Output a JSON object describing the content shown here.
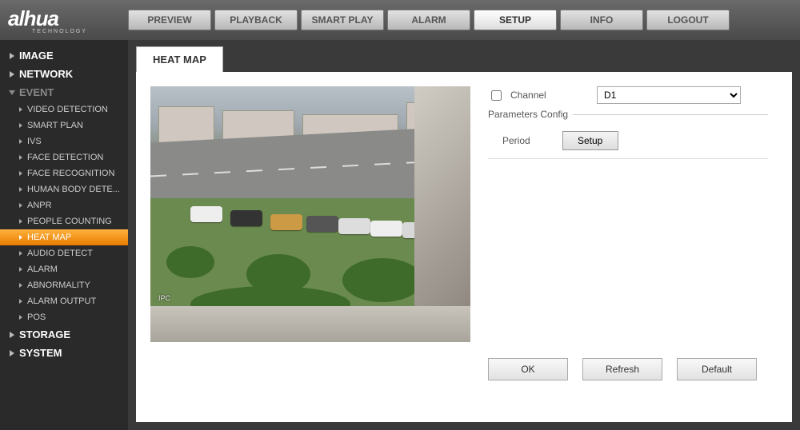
{
  "brand": {
    "name": "alhua",
    "sub": "TECHNOLOGY"
  },
  "tabs": [
    "PREVIEW",
    "PLAYBACK",
    "SMART PLAY",
    "ALARM",
    "SETUP",
    "INFO",
    "LOGOUT"
  ],
  "active_tab": "SETUP",
  "sidebar": {
    "groups": [
      {
        "label": "IMAGE",
        "expanded": false,
        "items": []
      },
      {
        "label": "NETWORK",
        "expanded": false,
        "items": []
      },
      {
        "label": "EVENT",
        "expanded": true,
        "items": [
          "VIDEO DETECTION",
          "SMART PLAN",
          "IVS",
          "FACE DETECTION",
          "FACE RECOGNITION",
          "HUMAN BODY DETE...",
          "ANPR",
          "PEOPLE COUNTING",
          "HEAT MAP",
          "AUDIO DETECT",
          "ALARM",
          "ABNORMALITY",
          "ALARM OUTPUT",
          "POS"
        ],
        "active": "HEAT MAP"
      },
      {
        "label": "STORAGE",
        "expanded": false,
        "items": []
      },
      {
        "label": "SYSTEM",
        "expanded": false,
        "items": []
      }
    ]
  },
  "content": {
    "title": "HEAT MAP",
    "overlay_ipc": "IPC",
    "channel_label": "Channel",
    "channel_value": "D1",
    "params_legend": "Parameters Config",
    "period_label": "Period",
    "setup_btn": "Setup",
    "btn_ok": "OK",
    "btn_refresh": "Refresh",
    "btn_default": "Default"
  }
}
